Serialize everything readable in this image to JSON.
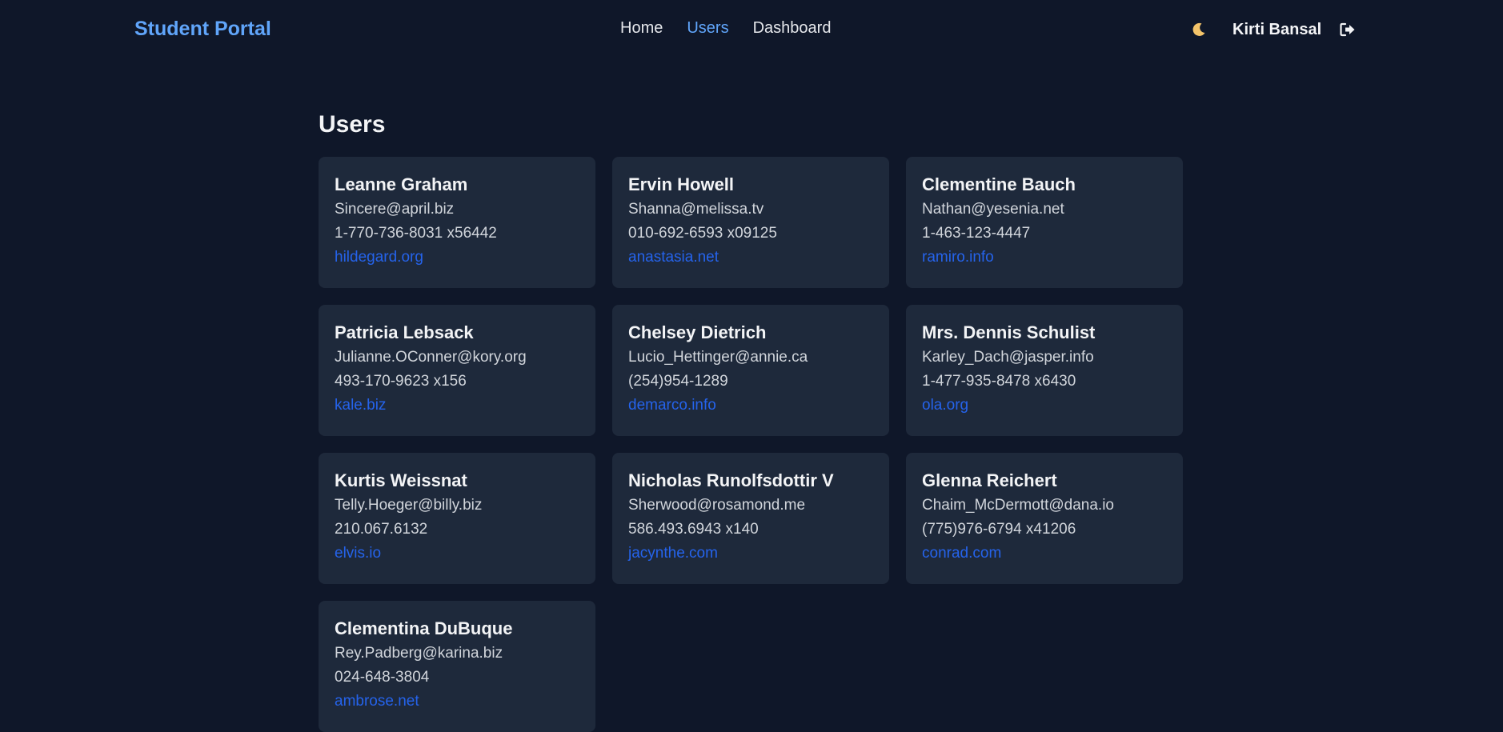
{
  "header": {
    "brand": "Student Portal",
    "nav": [
      {
        "label": "Home",
        "active": false
      },
      {
        "label": "Users",
        "active": true
      },
      {
        "label": "Dashboard",
        "active": false
      }
    ],
    "theme_icon": "moon-icon",
    "user_name": "Kirti Bansal",
    "logout_icon": "logout-icon"
  },
  "page": {
    "title": "Users"
  },
  "users": [
    {
      "name": "Leanne Graham",
      "email": "Sincere@april.biz",
      "phone": "1-770-736-8031 x56442",
      "website": "hildegard.org"
    },
    {
      "name": "Ervin Howell",
      "email": "Shanna@melissa.tv",
      "phone": "010-692-6593 x09125",
      "website": "anastasia.net"
    },
    {
      "name": "Clementine Bauch",
      "email": "Nathan@yesenia.net",
      "phone": "1-463-123-4447",
      "website": "ramiro.info"
    },
    {
      "name": "Patricia Lebsack",
      "email": "Julianne.OConner@kory.org",
      "phone": "493-170-9623 x156",
      "website": "kale.biz"
    },
    {
      "name": "Chelsey Dietrich",
      "email": "Lucio_Hettinger@annie.ca",
      "phone": "(254)954-1289",
      "website": "demarco.info"
    },
    {
      "name": "Mrs. Dennis Schulist",
      "email": "Karley_Dach@jasper.info",
      "phone": "1-477-935-8478 x6430",
      "website": "ola.org"
    },
    {
      "name": "Kurtis Weissnat",
      "email": "Telly.Hoeger@billy.biz",
      "phone": "210.067.6132",
      "website": "elvis.io"
    },
    {
      "name": "Nicholas Runolfsdottir V",
      "email": "Sherwood@rosamond.me",
      "phone": "586.493.6943 x140",
      "website": "jacynthe.com"
    },
    {
      "name": "Glenna Reichert",
      "email": "Chaim_McDermott@dana.io",
      "phone": "(775)976-6794 x41206",
      "website": "conrad.com"
    },
    {
      "name": "Clementina DuBuque",
      "email": "Rey.Padberg@karina.biz",
      "phone": "024-648-3804",
      "website": "ambrose.net"
    }
  ],
  "colors": {
    "background": "#0f1729",
    "card": "#1e293b",
    "accent": "#60a5fa",
    "link": "#2563eb"
  }
}
